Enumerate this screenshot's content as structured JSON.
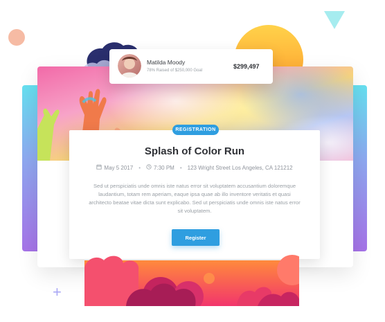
{
  "donor": {
    "name": "Matilda Moody",
    "subtitle": "78% Raised of $250,000 Goal",
    "amount": "$299,497"
  },
  "event": {
    "badge": "REGISTRATION",
    "title": "Splash of Color Run",
    "date": "May 5 2017",
    "time": "7:30 PM",
    "address": "123 Wright Street Los Angeles, CA 121212",
    "description": "Sed ut perspiciatis unde omnis iste natus error sit voluptatem accusantium doloremque laudantium, totam rem aperiam, eaque ipsa quae ab illo inventore veritatis et quasi architecto beatae vitae dicta sunt explicabo. Sed ut perspiciatis unde omnis iste natus error sit voluptatem.",
    "register_label": "Register",
    "separator": "•"
  },
  "icons": {
    "calendar": "calendar-icon",
    "clock": "clock-icon",
    "plus": "plus-icon"
  },
  "colors": {
    "accent": "#2f9ee0",
    "title": "#2f3136",
    "muted": "#9aa0a6"
  }
}
